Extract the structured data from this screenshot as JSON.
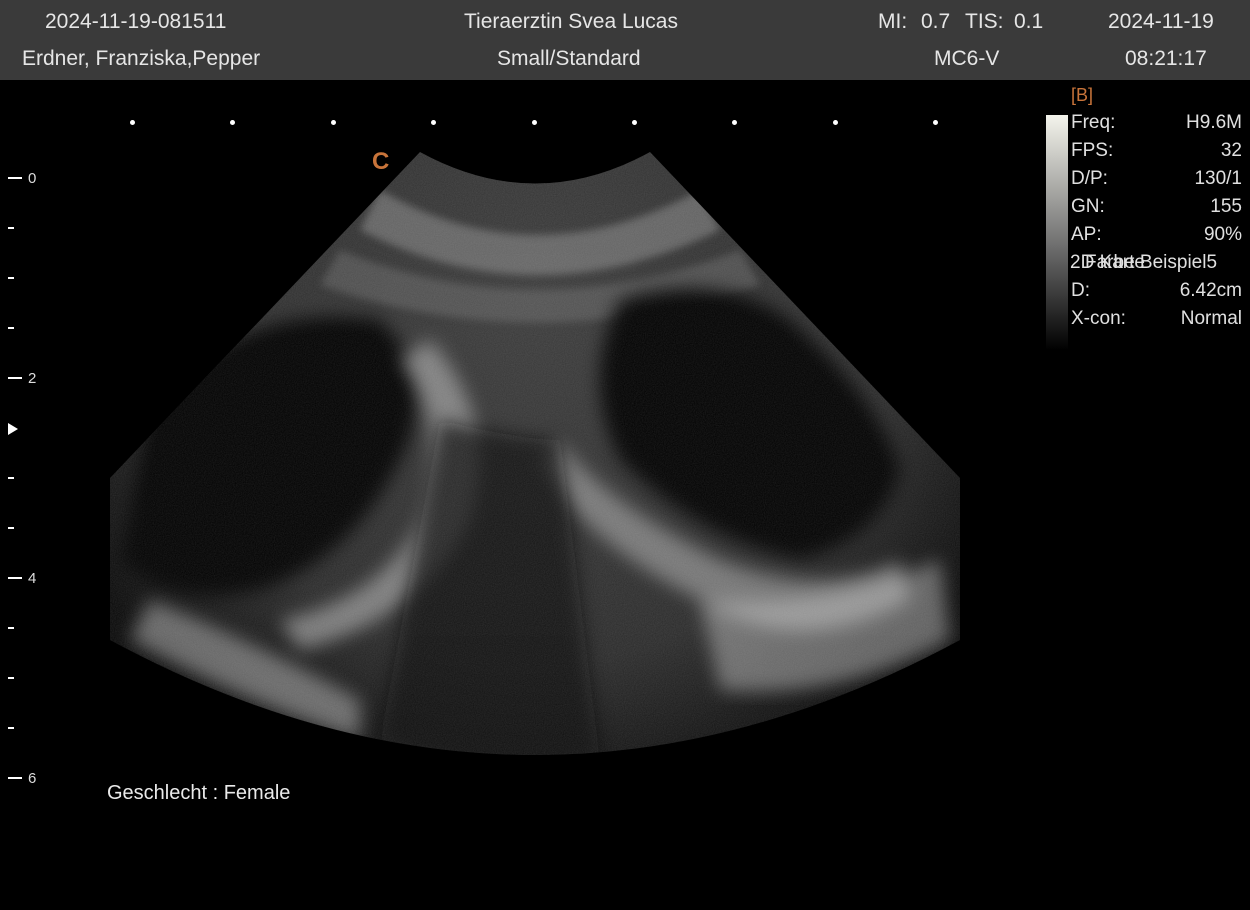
{
  "header": {
    "exam_id": "2024-11-19-081511",
    "patient": "Erdner, Franziska,Pepper",
    "operator": "Tieraerztin Svea Lucas",
    "preset": "Small/Standard",
    "mi_label": "MI:",
    "mi_value": "0.7",
    "tis_label": "TIS:",
    "tis_value": "0.1",
    "probe": "MC6-V",
    "date": "2024-11-19",
    "time": "08:21:17"
  },
  "image": {
    "orientation_marker": "C",
    "depth_labels": [
      "0",
      "2",
      "4",
      "6"
    ]
  },
  "params": {
    "mode": "[B]",
    "items": [
      {
        "label": "Freq:",
        "value": "H9.6M"
      },
      {
        "label": "FPS:",
        "value": "32"
      },
      {
        "label": "D/P:",
        "value": "130/1"
      },
      {
        "label": "GN:",
        "value": "155"
      },
      {
        "label": "AP:",
        "value": "90%"
      },
      {
        "label": "D:",
        "value": "6.42cm"
      },
      {
        "label": "X-con:",
        "value": "Normal"
      }
    ],
    "overlap_text_a": "2D Karte",
    "overlap_text_b": "Farbe Beispiel5"
  },
  "annotation": {
    "sex": "Geschlecht : Female"
  },
  "colors": {
    "topbar": "#3a3a3a",
    "marker": "#c8743a",
    "background": "#000000"
  }
}
